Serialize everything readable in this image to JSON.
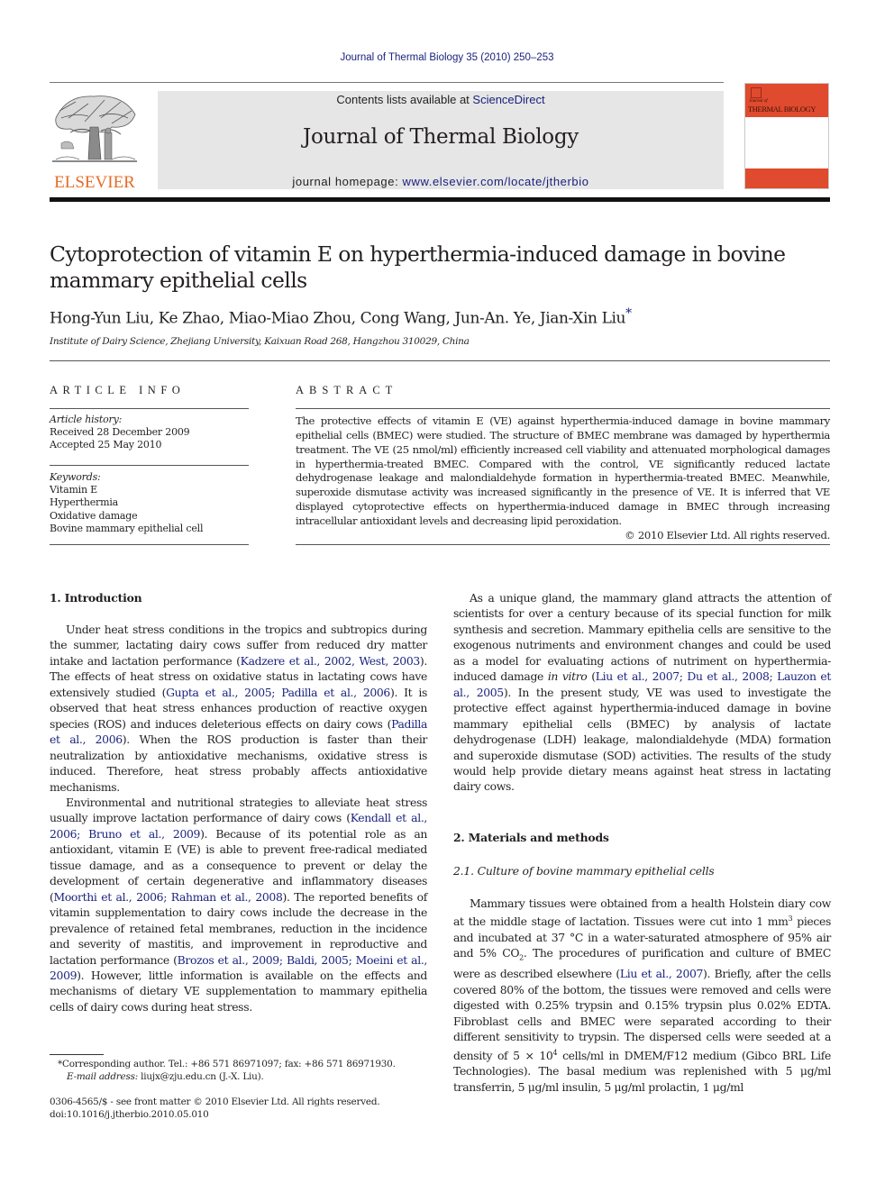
{
  "header": {
    "journal_ref": "Journal of Thermal Biology 35 (2010) 250–253",
    "contents_prefix": "Contents lists available at ",
    "contents_link": "ScienceDirect",
    "journal_title": "Journal of Thermal Biology",
    "homepage_prefix": "journal homepage: ",
    "homepage_link": "www.elsevier.com/locate/jtherbio",
    "publisher_logo_text": "ELSEVIER",
    "cover_small_text": "Journal of",
    "cover_title": "THERMAL BIOLOGY",
    "colors": {
      "cover_red": "#e04a2e",
      "elsevier_orange": "#e56b24",
      "link_blue": "#1a237e",
      "masthead_gray": "#e6e6e6"
    }
  },
  "article": {
    "title_line1": "Cytoprotection of vitamin E on hyperthermia-induced damage in bovine",
    "title_line2": "mammary epithelial cells",
    "authors": "Hong-Yun Liu, Ke Zhao, Miao-Miao Zhou, Cong Wang, Jun-An. Ye, Jian-Xin Liu",
    "corresponding_mark": "*",
    "affiliation": "Institute of Dairy Science, Zhejiang University, Kaixuan Road 268, Hangzhou 310029, China"
  },
  "article_info": {
    "heading": "ARTICLE INFO",
    "history_label": "Article history:",
    "received": "Received 28 December 2009",
    "accepted": "Accepted 25 May 2010",
    "keywords_label": "Keywords:",
    "keywords": [
      "Vitamin E",
      "Hyperthermia",
      "Oxidative damage",
      "Bovine mammary epithelial cell"
    ]
  },
  "abstract": {
    "heading": "ABSTRACT",
    "text": "The protective effects of vitamin E (VE) against hyperthermia-induced damage in bovine mammary epithelial cells (BMEC) were studied. The structure of BMEC membrane was damaged by hyperthermia treatment. The VE (25 nmol/ml) efficiently increased cell viability and attenuated morphological damages in hyperthermia-treated BMEC. Compared with the control, VE significantly reduced lactate dehydrogenase leakage and malondialdehyde formation in hyperthermia-treated BMEC. Meanwhile, superoxide dismutase activity was increased significantly in the presence of VE. It is inferred that VE displayed cytoprotective effects on hyperthermia-induced damage in BMEC through increasing intracellular antioxidant levels and decreasing lipid peroxidation.",
    "copyright": "© 2010 Elsevier Ltd. All rights reserved."
  },
  "left_column": {
    "section1_heading": "1.  Introduction",
    "p1": [
      {
        "t": "Under heat stress conditions in the tropics and subtropics during the summer, lactating dairy cows suffer from reduced dry matter intake and lactation performance ("
      },
      {
        "l": "Kadzere et al., 2002, West, 2003"
      },
      {
        "t": "). The effects of heat stress on oxidative status in lactating cows have extensively studied ("
      },
      {
        "l": "Gupta et al., 2005; Padilla et al., 2006"
      },
      {
        "t": "). It is observed that heat stress enhances production of reactive oxygen species (ROS) and induces deleter­ious effects on dairy cows ("
      },
      {
        "l": "Padilla et al., 2006"
      },
      {
        "t": "). When the ROS production is faster than their neutralization by antioxidative mechanisms, oxidative stress is induced. Therefore, heat stress probably affects antioxidative mechanisms."
      }
    ],
    "p2": [
      {
        "t": "Environmental and nutritional strategies to alleviate heat stress usually improve lactation performance of dairy cows ("
      },
      {
        "l": "Kendall et al., 2006; Bruno et al., 2009"
      },
      {
        "t": "). Because of its potential role as an antioxidant, vitamin E (VE) is able to prevent free-radical mediated tissue damage, and as a consequence to prevent or delay the development of certain degenerative and inflammatory diseases ("
      },
      {
        "l": "Moorthi et al., 2006; Rahman et al., 2008"
      },
      {
        "t": "). The reported benefits of vitamin supplementation to dairy cows include the decrease in the prevalence of retained fetal membranes, reduction in the incidence and severity of mastitis, and improvement in reproductive and lactation performance ("
      },
      {
        "l": "Brozos et al., 2009; Baldi, 2005; Moeini et al., 2009"
      },
      {
        "t": "). However, little information is available on the effects and mechanisms of dietary VE supplementation to mammary epithelia cells of dairy cows during heat stress."
      }
    ]
  },
  "right_column": {
    "p3": [
      {
        "t": "As a unique gland, the mammary gland attracts the attention of scientists for over a century because of its special function for milk synthesis and secretion. Mammary epithelia cells are sensitive to the exogenous nutriments and environment changes and could be used as a model for evaluating actions of nutriment on hyperthermia-induced damage "
      },
      {
        "i": "in vitro"
      },
      {
        "t": " ("
      },
      {
        "l": "Liu et al., 2007; Du et al., 2008; Lauzon et al., 2005"
      },
      {
        "t": "). In the present study, VE was used to investigate the protective effect against hyperthermia-induced damage in bovine mammary epithelial cells (BMEC) by analysis of lactate dehydrogenase (LDH) leakage, malondialdehyde (MDA) formation and superoxide dismutase (SOD) activities. The results of the study would help provide dietary means against heat stress in lactating dairy cows."
      }
    ],
    "section2_heading": "2.  Materials and methods",
    "subsection21_heading": "2.1.  Culture of bovine mammary epithelial cells",
    "p4": [
      {
        "t": "Mammary tissues were obtained from a health Holstein diary cow at the middle stage of lactation. Tissues were cut into 1 mm"
      },
      {
        "sup": "3"
      },
      {
        "t": " pieces and incubated at 37 °C in a water-saturated atmosphere of 95% air and 5% CO"
      },
      {
        "sub": "2"
      },
      {
        "t": ". The procedures of purification and culture of BMEC were as described elsewhere ("
      },
      {
        "l": "Liu et al., 2007"
      },
      {
        "t": "). Briefly, after the cells covered 80% of the bottom, the tissues were removed and cells were digested with 0.25% trypsin and 0.15% trypsin plus 0.02% EDTA. Fibroblast cells and BMEC were separated according to their different sensitivity to trypsin. The dispersed cells were seeded at a density of 5 × 10"
      },
      {
        "sup": "4"
      },
      {
        "t": " cells/ml in DMEM/F12 medium (Gibco BRL Life Technologies). The basal medium was replenished with 5 μg/ml transferrin, 5 μg/ml insulin, 5 μg/ml prolactin, 1 μg/ml"
      }
    ]
  },
  "footnotes": {
    "corresponding": "*Corresponding author. Tel.: +86 571 86971097; fax: +86 571 86971930.",
    "email_label": "E-mail address:",
    "email": " liujx@zju.edu.cn (J.-X. Liu).",
    "issn": "0306-4565/$ - see front matter © 2010 Elsevier Ltd. All rights reserved.",
    "doi": "doi:10.1016/j.jtherbio.2010.05.010"
  }
}
